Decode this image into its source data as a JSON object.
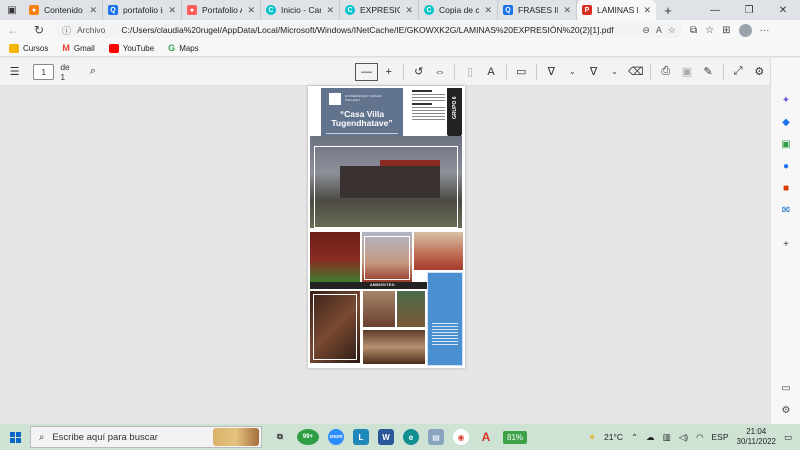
{
  "tabs": [
    {
      "label": "Contenido / 2",
      "icon": "moodle-icon",
      "color": "#f98012"
    },
    {
      "label": "portafolio isa",
      "icon": "search-icon",
      "color": "#1a73e8"
    },
    {
      "label": "Portafolio Ar",
      "icon": "adobe-icon",
      "color": "#ff5d5d"
    },
    {
      "label": "Inicio - Canva",
      "icon": "canva-icon",
      "color": "#00c4cc"
    },
    {
      "label": "EXPRESIÓN G",
      "icon": "canva-icon",
      "color": "#00c4cc"
    },
    {
      "label": "Copia de curr",
      "icon": "canva-icon",
      "color": "#00c4cc"
    },
    {
      "label": "FRASES INSPI",
      "icon": "search-icon",
      "color": "#1a73e8"
    },
    {
      "label": "LAMINAS EX",
      "icon": "pdf-icon",
      "color": "#d93025",
      "active": true
    }
  ],
  "address": {
    "archivo": "Archivo",
    "url": "C:/Users/claudia%20rugel/AppData/Local/Microsoft/Windows/INetCache/IE/GKOWXK2G/LAMINAS%20EXPRESIÓN%20(2)[1].pdf"
  },
  "bookmarks": [
    {
      "label": "Cursos",
      "color": "#f4b400"
    },
    {
      "label": "Gmail",
      "color": "#ea4335"
    },
    {
      "label": "YouTube",
      "color": "#ff0000"
    },
    {
      "label": "Maps",
      "color": "#34a853"
    }
  ],
  "pdf": {
    "page": "1",
    "total": "de 1"
  },
  "document": {
    "university": "UNIVERSIDAD CÉSAR VALLEJO",
    "title": "“Casa Villa Tugendhatave”",
    "group": "GRUPO 6",
    "section": "AMBIENTES:"
  },
  "taskbar": {
    "search_placeholder": "Escribe aquí para buscar",
    "badge": "99+",
    "battery": "81%",
    "weather": "21°C",
    "language": "ESP",
    "time": "21:04",
    "date": "30/11/2022"
  }
}
